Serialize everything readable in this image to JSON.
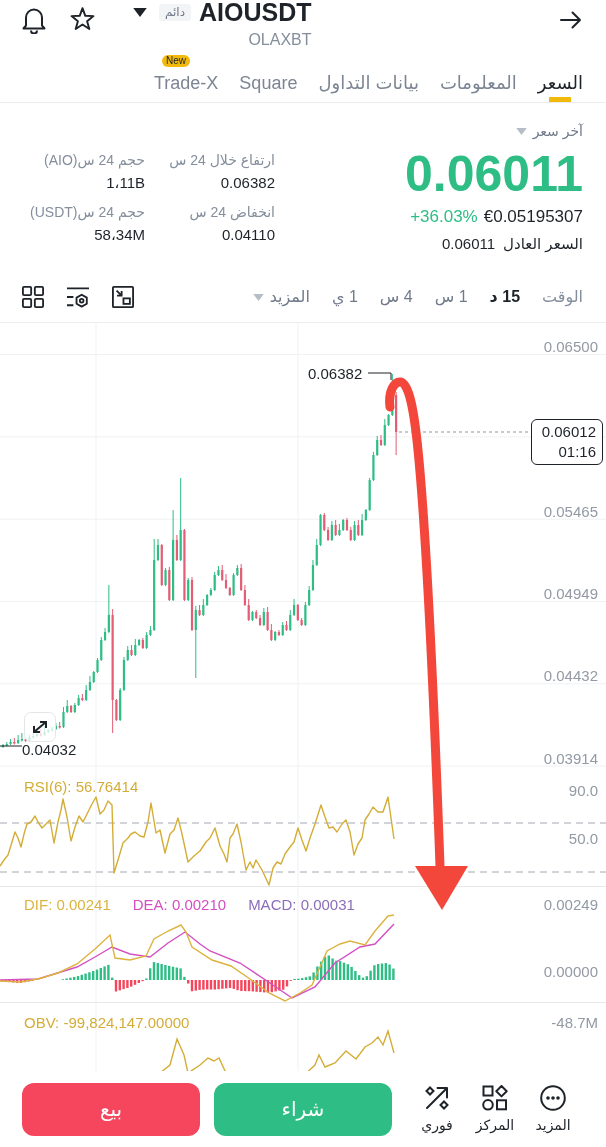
{
  "header": {
    "symbol": "AIOUSDT",
    "contract_badge": "دائم",
    "subtitle": "OLAXBT"
  },
  "tabs": [
    {
      "label": "السعر",
      "selected": true
    },
    {
      "label": "المعلومات",
      "selected": false
    },
    {
      "label": "بيانات التداول",
      "selected": false
    },
    {
      "label": "Square",
      "selected": false
    },
    {
      "label": "Trade-X",
      "selected": false,
      "badge": "New"
    }
  ],
  "price": {
    "selector": "آخر سعر",
    "last": "0.06011",
    "converted": "€0.05195307",
    "change": "+36.03%",
    "fair_label": "السعر العادل",
    "fair_value": "0.06011"
  },
  "stats": [
    {
      "label": "ارتفاع خلال 24 س",
      "value": "0.06382"
    },
    {
      "label": "حجم 24 س(AIO)",
      "value": "1،11B"
    },
    {
      "label": "انخفاض 24 س",
      "value": "0.04110"
    },
    {
      "label": "حجم 24 س(USDT)",
      "value": "58،34M"
    }
  ],
  "timeframes": {
    "label": "الوقت",
    "items": [
      {
        "label": "15 د",
        "selected": true
      },
      {
        "label": "1 س",
        "selected": false
      },
      {
        "label": "4 س",
        "selected": false
      },
      {
        "label": "1 ي",
        "selected": false
      }
    ],
    "more": "المزيد"
  },
  "price_chart": {
    "axis": [
      "0.06500",
      "0.05465",
      "0.04949",
      "0.04432",
      "0.03914"
    ],
    "last_price": "0.06012",
    "countdown": "01:16",
    "high_label": "0.06382",
    "low_label": "0.04032"
  },
  "rsi": {
    "legend": "RSI(6): 56.76414",
    "axis": [
      "90.0",
      "50.0"
    ]
  },
  "macd": {
    "legend": [
      {
        "text": "MACD: 0.00031",
        "color": "#8b6dbb"
      },
      {
        "text": "DEA: 0.00210",
        "color": "#d44fc2"
      },
      {
        "text": "DIF: 0.00241",
        "color": "#dcb33e"
      }
    ],
    "axis": [
      "0.00249",
      "0.00000"
    ]
  },
  "obv": {
    "legend": "OBV: -99,824,147.00000",
    "axis": [
      "-48.7M"
    ]
  },
  "bottom_bar": {
    "actions": [
      {
        "label": "المزيد",
        "kind": "more"
      },
      {
        "label": "المركز",
        "kind": "position"
      },
      {
        "label": "فوري",
        "kind": "instant"
      }
    ],
    "trade_buttons": [
      {
        "label": "شراء",
        "kind": "buy"
      },
      {
        "label": "بيع",
        "kind": "sell"
      }
    ]
  }
}
